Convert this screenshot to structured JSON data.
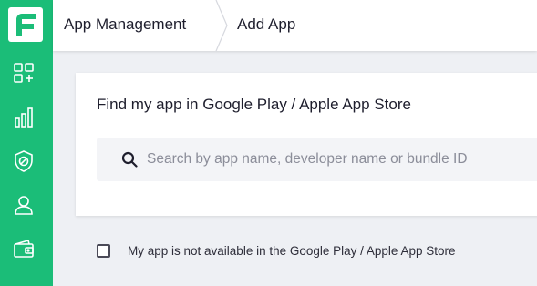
{
  "colors": {
    "brand": "#1bbd78",
    "text": "#1e1e2d",
    "background": "#eef0f4"
  },
  "sidebar": {
    "logo": "brand-logo-icon",
    "items": [
      {
        "icon": "apps-add-icon"
      },
      {
        "icon": "bar-chart-icon"
      },
      {
        "icon": "shield-block-icon"
      },
      {
        "icon": "user-icon"
      },
      {
        "icon": "wallet-icon"
      }
    ]
  },
  "breadcrumb": {
    "root": "App Management",
    "current": "Add App"
  },
  "find_app": {
    "title": "Find my app in Google Play / Apple App Store",
    "search_placeholder": "Search by app name, developer name or bundle ID",
    "search_value": ""
  },
  "not_available": {
    "checked": false,
    "label": "My app is not available in the Google Play / Apple App Store"
  }
}
